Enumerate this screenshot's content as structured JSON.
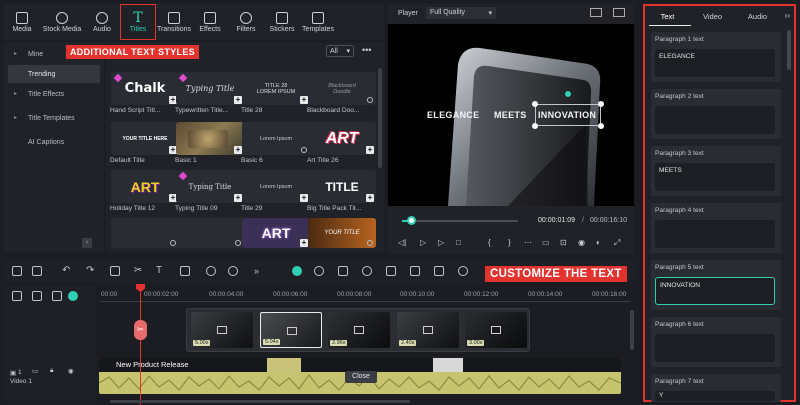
{
  "toolbar": {
    "items": [
      {
        "label": "Media",
        "icon": "media-icon"
      },
      {
        "label": "Stock Media",
        "icon": "stock-media-icon"
      },
      {
        "label": "Audio",
        "icon": "audio-icon"
      },
      {
        "label": "Titles",
        "icon": "titles-icon"
      },
      {
        "label": "Transitions",
        "icon": "transitions-icon"
      },
      {
        "label": "Effects",
        "icon": "effects-icon"
      },
      {
        "label": "Filters",
        "icon": "filters-icon"
      },
      {
        "label": "Stickers",
        "icon": "stickers-icon"
      },
      {
        "label": "Templates",
        "icon": "templates-icon"
      }
    ],
    "active": "Titles"
  },
  "sidebar": {
    "items": [
      {
        "label": "Mine"
      },
      {
        "label": "Trending"
      },
      {
        "label": "Title Effects"
      },
      {
        "label": "Title Templates"
      },
      {
        "label": "AI Captions"
      }
    ]
  },
  "annotations": {
    "additional": "ADDITIONAL TEXT STYLES",
    "customize": "CUSTOMIZE THE TEXT"
  },
  "filter": {
    "label": "All"
  },
  "titles": [
    {
      "name": "Hand Script Titl...",
      "thumb_text": "Chalk"
    },
    {
      "name": "Typewritten Title...",
      "thumb_text": "Typing Title"
    },
    {
      "name": "Title 28",
      "thumb_text": "TITLE 28 LOREM IPSUM"
    },
    {
      "name": "Blackboard Doo...",
      "thumb_text": "Blackboard Doodle"
    },
    {
      "name": "Default Title",
      "thumb_text": "YOUR TITLE HERE"
    },
    {
      "name": "Basic 1",
      "thumb_text": ""
    },
    {
      "name": "Basic 6",
      "thumb_text": "Lorem Ipsum"
    },
    {
      "name": "Art Title 26",
      "thumb_text": "ART"
    },
    {
      "name": "Holiday Title 12",
      "thumb_text": "ART"
    },
    {
      "name": "Typing Title 09",
      "thumb_text": "Typing Title"
    },
    {
      "name": "Title 29",
      "thumb_text": "Lorem Ipsum"
    },
    {
      "name": "Big Title Pack Tit...",
      "thumb_text": "TITLE"
    },
    {
      "name": "",
      "thumb_text": ""
    },
    {
      "name": "",
      "thumb_text": ""
    },
    {
      "name": "",
      "thumb_text": "ART"
    },
    {
      "name": "",
      "thumb_text": "YOUR TITLE"
    }
  ],
  "player": {
    "label": "Player",
    "quality": "Full Quality",
    "overlay_words": [
      "ELEGANCE",
      "MEETS",
      "INNOVATION"
    ],
    "current_time": "00:00:01:09",
    "total_time": "00:00:16:10",
    "progress": 0.08
  },
  "right_panel": {
    "tabs": [
      "Text",
      "Video",
      "Audio"
    ],
    "active_tab": "Text",
    "paragraphs": [
      {
        "label": "Paragraph 1 text",
        "value": "ELEGANCE"
      },
      {
        "label": "Paragraph 2 text",
        "value": ""
      },
      {
        "label": "Paragraph 3 text",
        "value": "MEETS"
      },
      {
        "label": "Paragraph 4 text",
        "value": ""
      },
      {
        "label": "Paragraph 5 text",
        "value": "INNOVATION"
      },
      {
        "label": "Paragraph 6 text",
        "value": ""
      },
      {
        "label": "Paragraph 7 text",
        "value": "Y"
      }
    ]
  },
  "timeline": {
    "ruler": [
      "00:00",
      "00:00:02:00",
      "00:00:04:00",
      "00:00:06:00",
      "00:00:08:00",
      "00:00:10:00",
      "00:00:12:00",
      "00:00:14:00",
      "00:00:16:00"
    ],
    "clips": [
      {
        "duration": "5.00s"
      },
      {
        "duration": "5.04s"
      },
      {
        "duration": "2.96s"
      },
      {
        "duration": "2.40s"
      },
      {
        "duration": "3.00s"
      }
    ],
    "video_clip_title": "New Product Release",
    "close_label": "Close",
    "track_label": "Video 1",
    "track_number": "1"
  },
  "colors": {
    "accent": "#2fd0b3",
    "annotation_red": "#e3332e",
    "panel_bg": "#202228"
  }
}
